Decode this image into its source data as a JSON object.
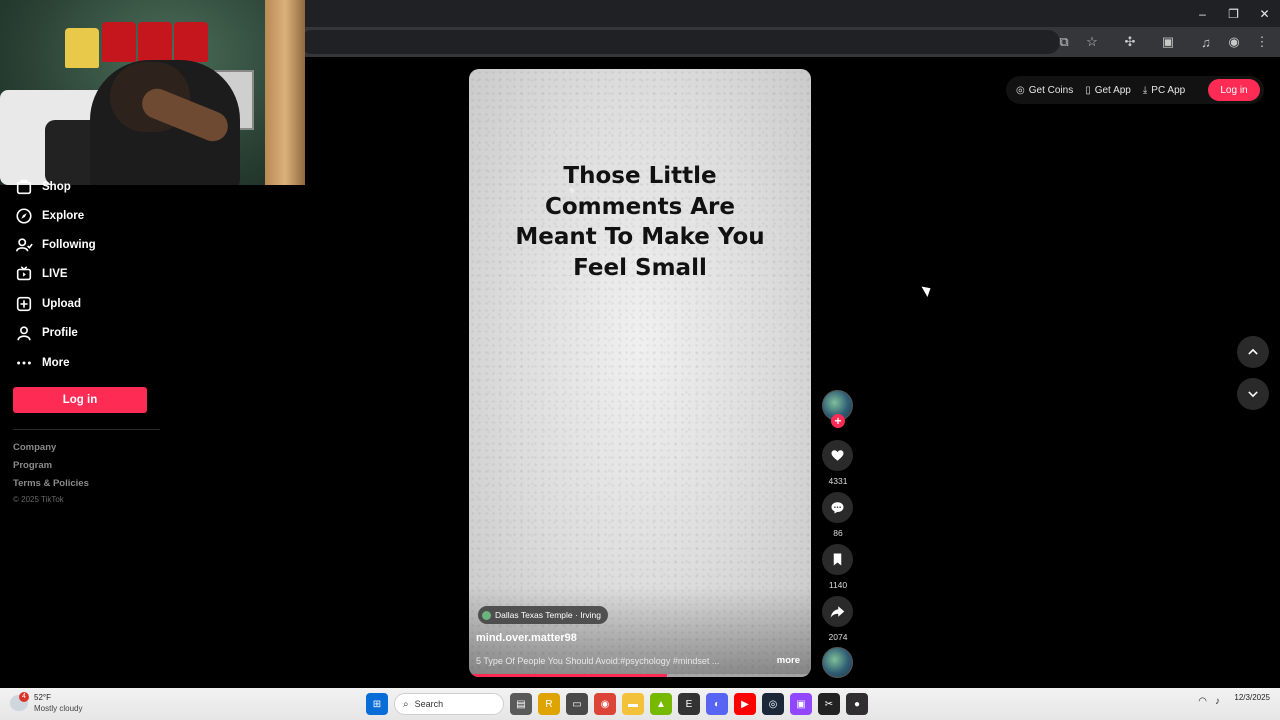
{
  "window": {
    "controls": {
      "minimize": "–",
      "restore": "❐",
      "close": "✕"
    }
  },
  "toolbar": {
    "icons": [
      "install-icon",
      "star-icon",
      "extensions-icon",
      "tab-search-icon",
      "media-icon",
      "profile-icon",
      "menu-icon"
    ]
  },
  "sidebar": {
    "items": [
      {
        "label": "Shop",
        "icon": "shop-icon"
      },
      {
        "label": "Explore",
        "icon": "compass-icon"
      },
      {
        "label": "Following",
        "icon": "following-icon"
      },
      {
        "label": "LIVE",
        "icon": "live-icon"
      },
      {
        "label": "Upload",
        "icon": "upload-icon"
      },
      {
        "label": "Profile",
        "icon": "profile-icon"
      },
      {
        "label": "More",
        "icon": "more-icon"
      }
    ],
    "login_label": "Log in",
    "footer": {
      "company": "Company",
      "program": "Program",
      "terms": "Terms & Policies",
      "copyright": "© 2025 TikTok"
    }
  },
  "header": {
    "get_coins": "Get Coins",
    "get_app": "Get App",
    "pc_app": "PC App",
    "login_label": "Log in"
  },
  "video": {
    "caption_lines": [
      "Those Little",
      "Comments Are",
      "Meant To Make You",
      "Feel Small"
    ],
    "location": "Dallas Texas Temple · Irving",
    "author": "mind.over.matter98",
    "description": "5 Type Of People You Should Avoid:#psychology #mindset ...",
    "more_label": "more",
    "progress": 0.58
  },
  "actions": {
    "likes": "4331",
    "comments": "86",
    "saves": "1140",
    "shares": "2074"
  },
  "taskbar": {
    "weather_badge": "4",
    "weather_temp": "52°F",
    "weather_desc": "Mostly cloudy",
    "search_placeholder": "Search",
    "clock_time": "",
    "clock_date": "12/3/2025"
  }
}
